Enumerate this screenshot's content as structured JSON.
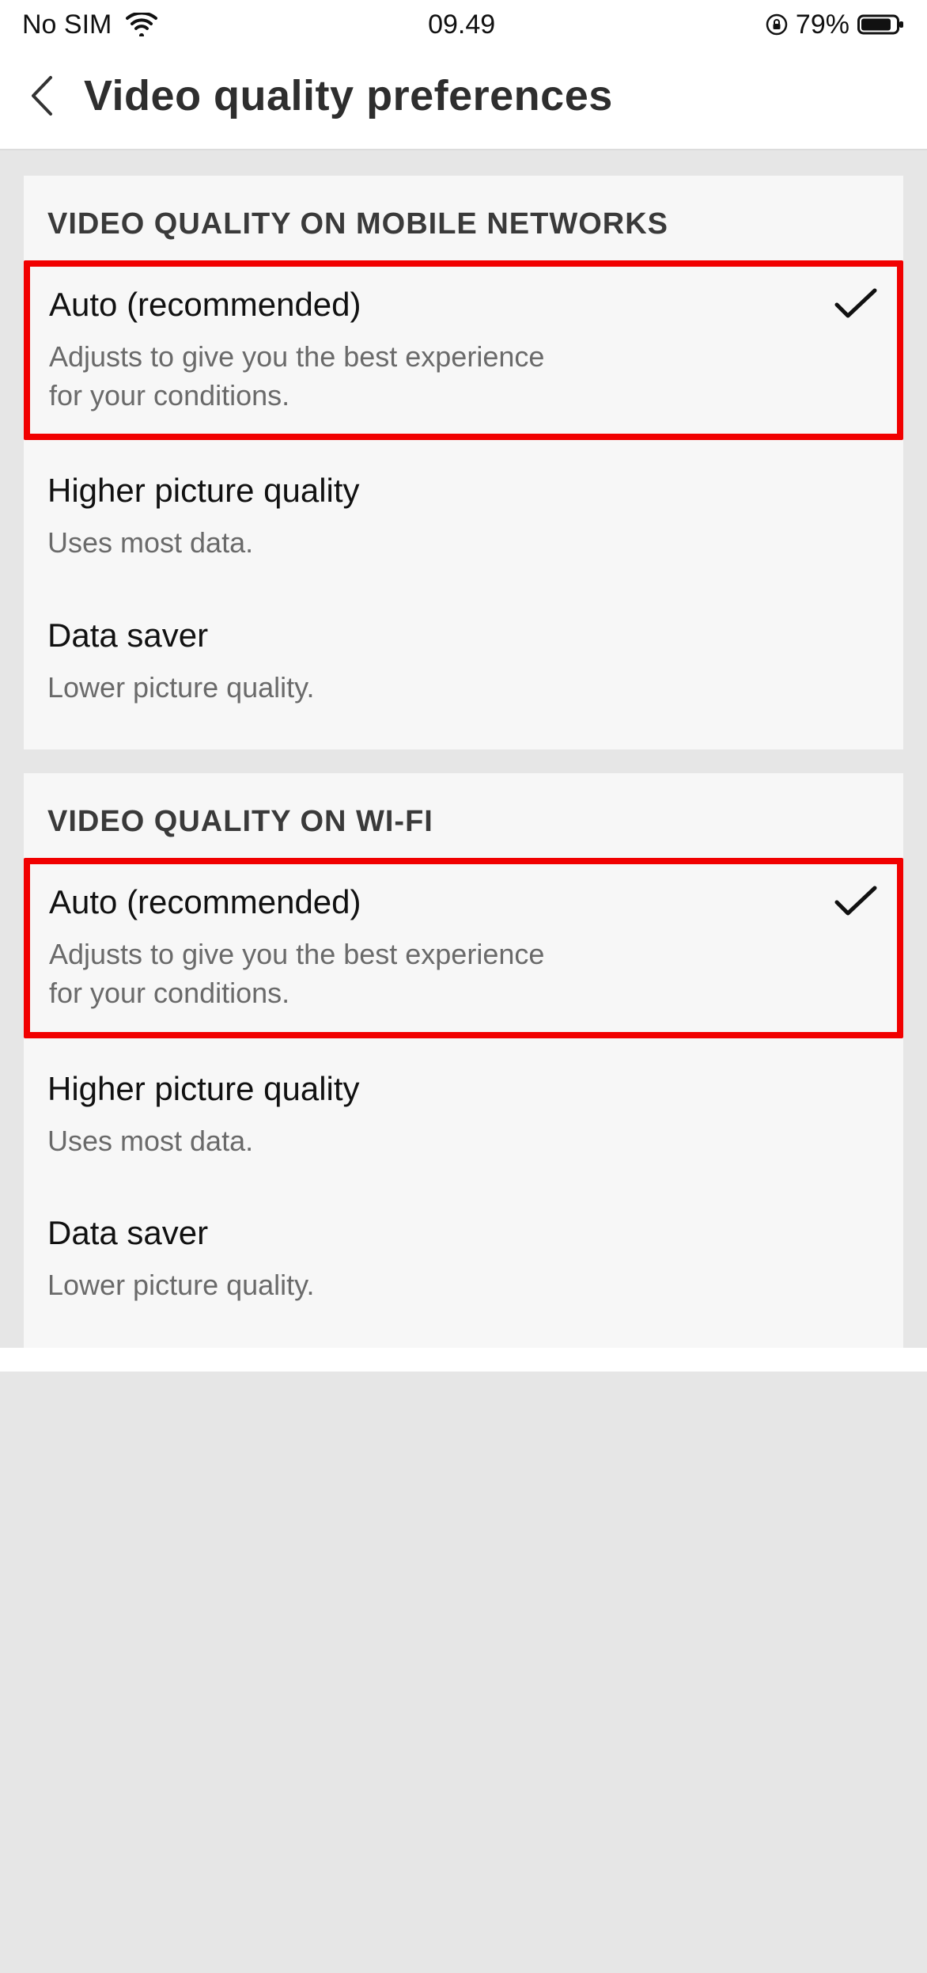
{
  "statusBar": {
    "carrier": "No SIM",
    "time": "09.49",
    "battery": "79%"
  },
  "header": {
    "title": "Video quality preferences"
  },
  "sections": [
    {
      "title": "VIDEO QUALITY ON MOBILE NETWORKS",
      "options": [
        {
          "title": "Auto (recommended)",
          "subtitle": "Adjusts to give you the best experience for your conditions.",
          "selected": true,
          "highlighted": true
        },
        {
          "title": "Higher picture quality",
          "subtitle": "Uses most data.",
          "selected": false,
          "highlighted": false
        },
        {
          "title": "Data saver",
          "subtitle": "Lower picture quality.",
          "selected": false,
          "highlighted": false
        }
      ]
    },
    {
      "title": "VIDEO QUALITY ON WI-FI",
      "options": [
        {
          "title": "Auto (recommended)",
          "subtitle": "Adjusts to give you the best experience for your conditions.",
          "selected": true,
          "highlighted": true
        },
        {
          "title": "Higher picture quality",
          "subtitle": "Uses most data.",
          "selected": false,
          "highlighted": false
        },
        {
          "title": "Data saver",
          "subtitle": "Lower picture quality.",
          "selected": false,
          "highlighted": false
        }
      ]
    }
  ]
}
